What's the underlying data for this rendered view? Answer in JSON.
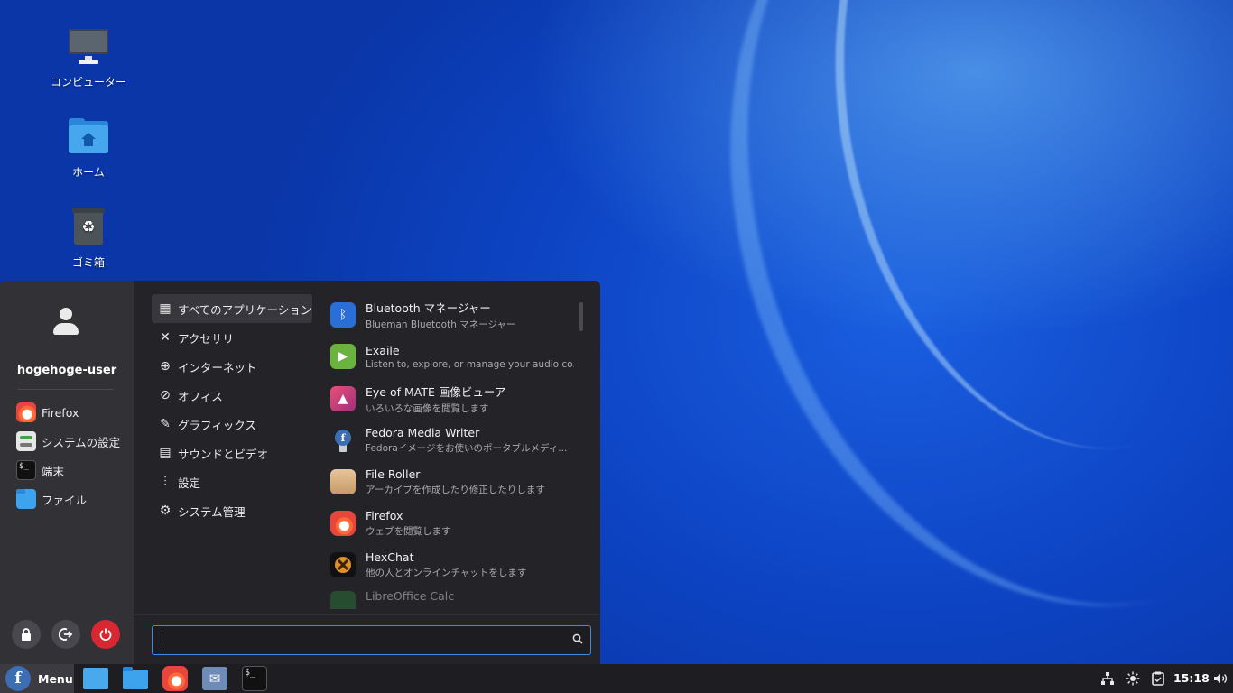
{
  "desktop": {
    "icons": [
      {
        "label": "コンピューター",
        "icon": "computer-icon"
      },
      {
        "label": "ホーム",
        "icon": "home-folder-icon"
      },
      {
        "label": "ゴミ箱",
        "icon": "trash-icon"
      }
    ]
  },
  "menu": {
    "user": {
      "name": "hogehoge-user",
      "icon": "user-avatar-icon"
    },
    "favorites": [
      {
        "label": "Firefox",
        "icon": "firefox-icon"
      },
      {
        "label": "システムの設定",
        "icon": "settings-icon"
      },
      {
        "label": "端末",
        "icon": "terminal-icon"
      },
      {
        "label": "ファイル",
        "icon": "files-icon"
      }
    ],
    "system_buttons": [
      {
        "name": "lock",
        "icon": "lock-icon"
      },
      {
        "name": "logout",
        "icon": "logout-icon"
      },
      {
        "name": "shutdown",
        "icon": "power-icon",
        "color": "#d92731"
      }
    ],
    "categories": [
      {
        "label": "すべてのアプリケーション",
        "icon": "grid-icon",
        "active": true
      },
      {
        "label": "アクセサリ",
        "icon": "tools-icon"
      },
      {
        "label": "インターネット",
        "icon": "globe-icon"
      },
      {
        "label": "オフィス",
        "icon": "paperclip-icon"
      },
      {
        "label": "グラフィックス",
        "icon": "palette-icon"
      },
      {
        "label": "サウンドとビデオ",
        "icon": "film-icon"
      },
      {
        "label": "設定",
        "icon": "sliders-icon"
      },
      {
        "label": "システム管理",
        "icon": "gear-icon"
      }
    ],
    "apps": [
      {
        "name": "Bluetooth マネージャー",
        "desc": "Blueman Bluetooth マネージャー",
        "icon": "bluetooth-icon"
      },
      {
        "name": "Exaile",
        "desc": "Listen to, explore, or manage your audio co...",
        "icon": "exaile-icon"
      },
      {
        "name": "Eye of MATE 画像ビューア",
        "desc": "いろいろな画像を閲覧します",
        "icon": "image-viewer-icon"
      },
      {
        "name": "Fedora Media Writer",
        "desc": "Fedoraイメージをお使いのポータブルメディ...",
        "icon": "fedora-media-writer-icon"
      },
      {
        "name": "File Roller",
        "desc": "アーカイブを作成したり修正したりします",
        "icon": "archive-icon"
      },
      {
        "name": "Firefox",
        "desc": "ウェブを閲覧します",
        "icon": "firefox-icon"
      },
      {
        "name": "HexChat",
        "desc": "他の人とオンラインチャットをします",
        "icon": "hexchat-icon"
      },
      {
        "name": "LibreOffice Calc",
        "desc": "",
        "icon": "libreoffice-calc-icon"
      }
    ],
    "search": {
      "value": "",
      "placeholder": "",
      "icon": "search-icon"
    }
  },
  "taskbar": {
    "menu_label": "Menu",
    "launchers": [
      {
        "name": "show-desktop",
        "icon": "desktop-window-icon"
      },
      {
        "name": "files",
        "icon": "folder-icon"
      },
      {
        "name": "firefox",
        "icon": "firefox-icon"
      },
      {
        "name": "mail",
        "icon": "mail-icon"
      },
      {
        "name": "terminal",
        "icon": "terminal-icon"
      }
    ],
    "tray": [
      {
        "name": "network",
        "icon": "network-icon"
      },
      {
        "name": "redshift",
        "icon": "brightness-icon"
      },
      {
        "name": "clipboard",
        "icon": "clipboard-icon"
      }
    ],
    "clock": "15:18",
    "volume_icon": "volume-icon"
  },
  "colors": {
    "accent": "#3a8ee6",
    "power": "#d92731",
    "fedora": "#3c6eb4"
  }
}
